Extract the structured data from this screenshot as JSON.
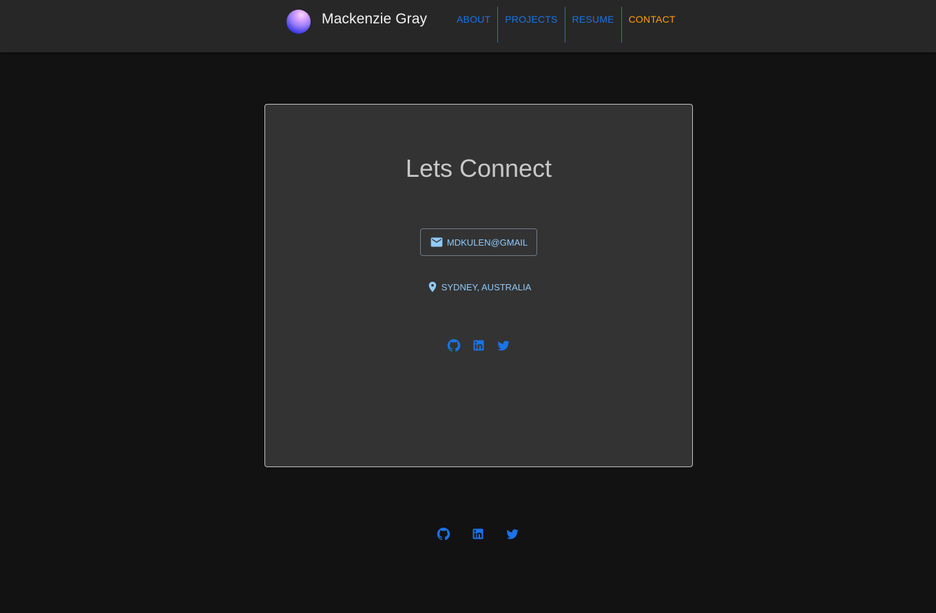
{
  "theme": {
    "page_bg": "#121212",
    "appbar_bg": "#272727",
    "card_bg": "#333333",
    "link_blue": "#1a73e8",
    "active_orange": "#ffa000",
    "light_blue": "#90caf9"
  },
  "header": {
    "brand_name": "Mackenzie Gray",
    "logo_icon": "gradient-sphere-logo",
    "nav": [
      {
        "label": "ABOUT",
        "active": false
      },
      {
        "label": "PROJECTS",
        "active": false
      },
      {
        "label": "RESUME",
        "active": false
      },
      {
        "label": "CONTACT",
        "active": true
      }
    ]
  },
  "contact": {
    "title": "Lets Connect",
    "email_label": "MDKULEN@GMAIL",
    "email_icon": "mail-icon",
    "location_label": "SYDNEY, AUSTRALIA",
    "location_icon": "location-pin-icon",
    "social_icons": [
      "github-icon",
      "linkedin-icon",
      "twitter-icon"
    ]
  },
  "footer": {
    "social_icons": [
      "github-icon",
      "linkedin-icon",
      "twitter-icon"
    ]
  }
}
